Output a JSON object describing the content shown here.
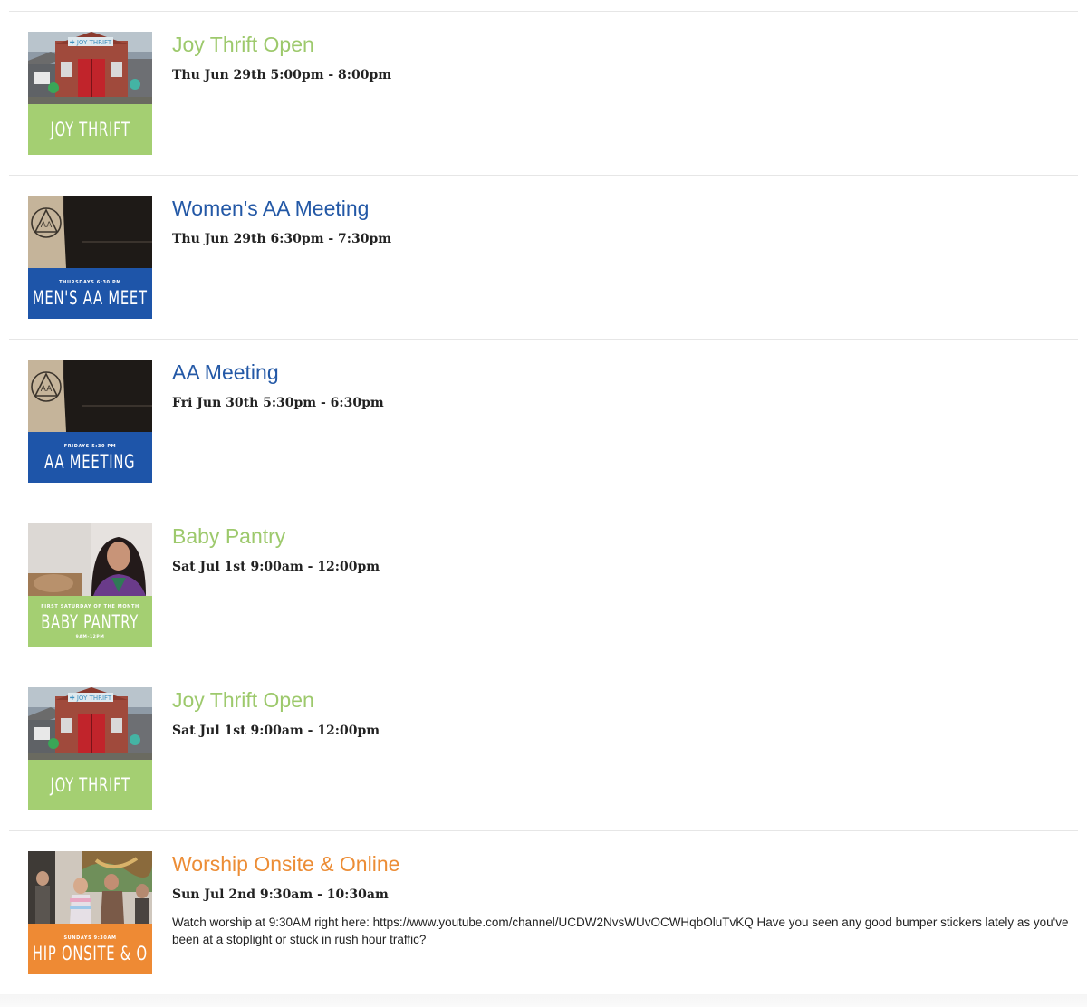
{
  "colors": {
    "green": "#9dc96c",
    "blue": "#2358a6",
    "orange": "#ec8d36",
    "band_green": "#a4cf72",
    "band_blue": "#1e55a9",
    "band_orange": "#ee8a34"
  },
  "events": [
    {
      "title": "Joy Thrift Open",
      "when": "Thu Jun 29th 5:00pm - 8:00pm",
      "thumb": {
        "top_text": "",
        "big_text": "JOY THRIFT",
        "bottom_text": "",
        "photo": "church-building-photo"
      }
    },
    {
      "title": "Women's AA Meeting",
      "when": "Thu Jun 29th 6:30pm - 7:30pm",
      "thumb": {
        "top_text": "THURSDAYS 6:30 PM",
        "big_text": "MEN'S AA MEET",
        "bottom_text": "",
        "photo": "aa-sign-photo"
      }
    },
    {
      "title": "AA Meeting",
      "when": "Fri Jun 30th 5:30pm - 6:30pm",
      "thumb": {
        "top_text": "FRIDAYS 5:30 PM",
        "big_text": "AA MEETING",
        "bottom_text": "",
        "photo": "aa-sign-photo"
      }
    },
    {
      "title": "Baby Pantry",
      "when": "Sat Jul 1st 9:00am - 12:00pm",
      "thumb": {
        "top_text": "FIRST SATURDAY OF THE MONTH",
        "big_text": "BABY PANTRY",
        "bottom_text": "9AM-12PM",
        "photo": "woman-portrait-photo"
      }
    },
    {
      "title": "Joy Thrift Open",
      "when": "Sat Jul 1st 9:00am - 12:00pm",
      "thumb": {
        "top_text": "",
        "big_text": "JOY THRIFT",
        "bottom_text": "",
        "photo": "church-building-photo"
      }
    },
    {
      "title": "Worship Onsite & Online",
      "when": "Sun Jul 2nd 9:30am - 10:30am",
      "description": "Watch worship at 9:30AM right here: https://www.youtube.com/channel/UCDW2NvsWUvOCWHqbOluTvKQ Have you seen any good bumper stickers lately as you've been at a stoplight or stuck in rush hour traffic?",
      "thumb": {
        "top_text": "SUNDAYS 9:30AM",
        "big_text": "HIP ONSITE & O",
        "bottom_text": "",
        "photo": "worship-singers-photo"
      }
    }
  ]
}
